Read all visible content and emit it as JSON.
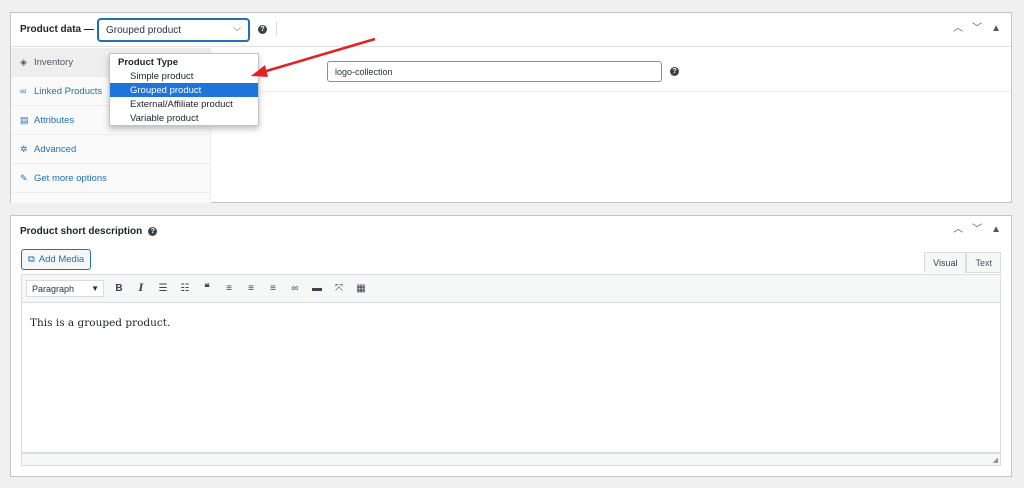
{
  "product_data": {
    "title": "Product data —",
    "select_value": "Grouped product",
    "help": "?",
    "tabs": [
      {
        "label": "Inventory",
        "icon": "tag-icon"
      },
      {
        "label": "Linked Products",
        "icon": "link-icon"
      },
      {
        "label": "Attributes",
        "icon": "table-icon"
      },
      {
        "label": "Advanced",
        "icon": "gear-icon"
      },
      {
        "label": "Get more options",
        "icon": "plugin-icon"
      }
    ],
    "field_value": "logo-collection"
  },
  "dropdown": {
    "group": "Product Type",
    "options": [
      "Simple product",
      "Grouped product",
      "External/Affiliate product",
      "Variable product"
    ],
    "selected": "Grouped product"
  },
  "short_description": {
    "title": "Product short description",
    "add_media": "Add Media",
    "editor_tabs": [
      "Visual",
      "Text"
    ],
    "format": "Paragraph",
    "content": "This is a grouped product."
  },
  "colors": {
    "accent": "#2271b1",
    "selected_option": "#1e74d9",
    "annotation_arrow": "#e02424"
  }
}
